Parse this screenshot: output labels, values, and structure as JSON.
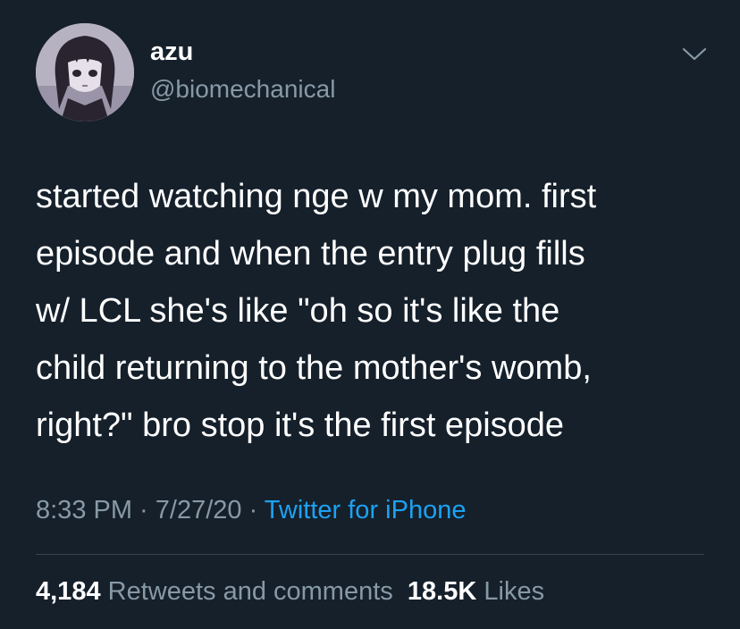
{
  "author": {
    "display_name": "azu",
    "handle": "@biomechanical",
    "avatar": "anime-character-avatar"
  },
  "tweet": {
    "lines": [
      "started watching nge w my mom. first",
      "episode and when the entry plug fills",
      "w/ LCL she's like \"oh so it's like the",
      "child returning to the mother's womb,",
      "right?\" bro stop it's the first episode"
    ]
  },
  "meta": {
    "time": "8:33 PM",
    "sep1": " · ",
    "date": "7/27/20",
    "sep2": " · ",
    "source": "Twitter for iPhone"
  },
  "stats": {
    "retweets_count": "4,184",
    "retweets_label": "Retweets and comments",
    "likes_count": "18.5K",
    "likes_label": "Likes"
  },
  "icons": {
    "menu": "chevron-down-icon"
  },
  "colors": {
    "background": "#15202b",
    "primary_text": "#ffffff",
    "secondary_text": "#8899a6",
    "link": "#1da1f2",
    "divider": "#38444d"
  }
}
